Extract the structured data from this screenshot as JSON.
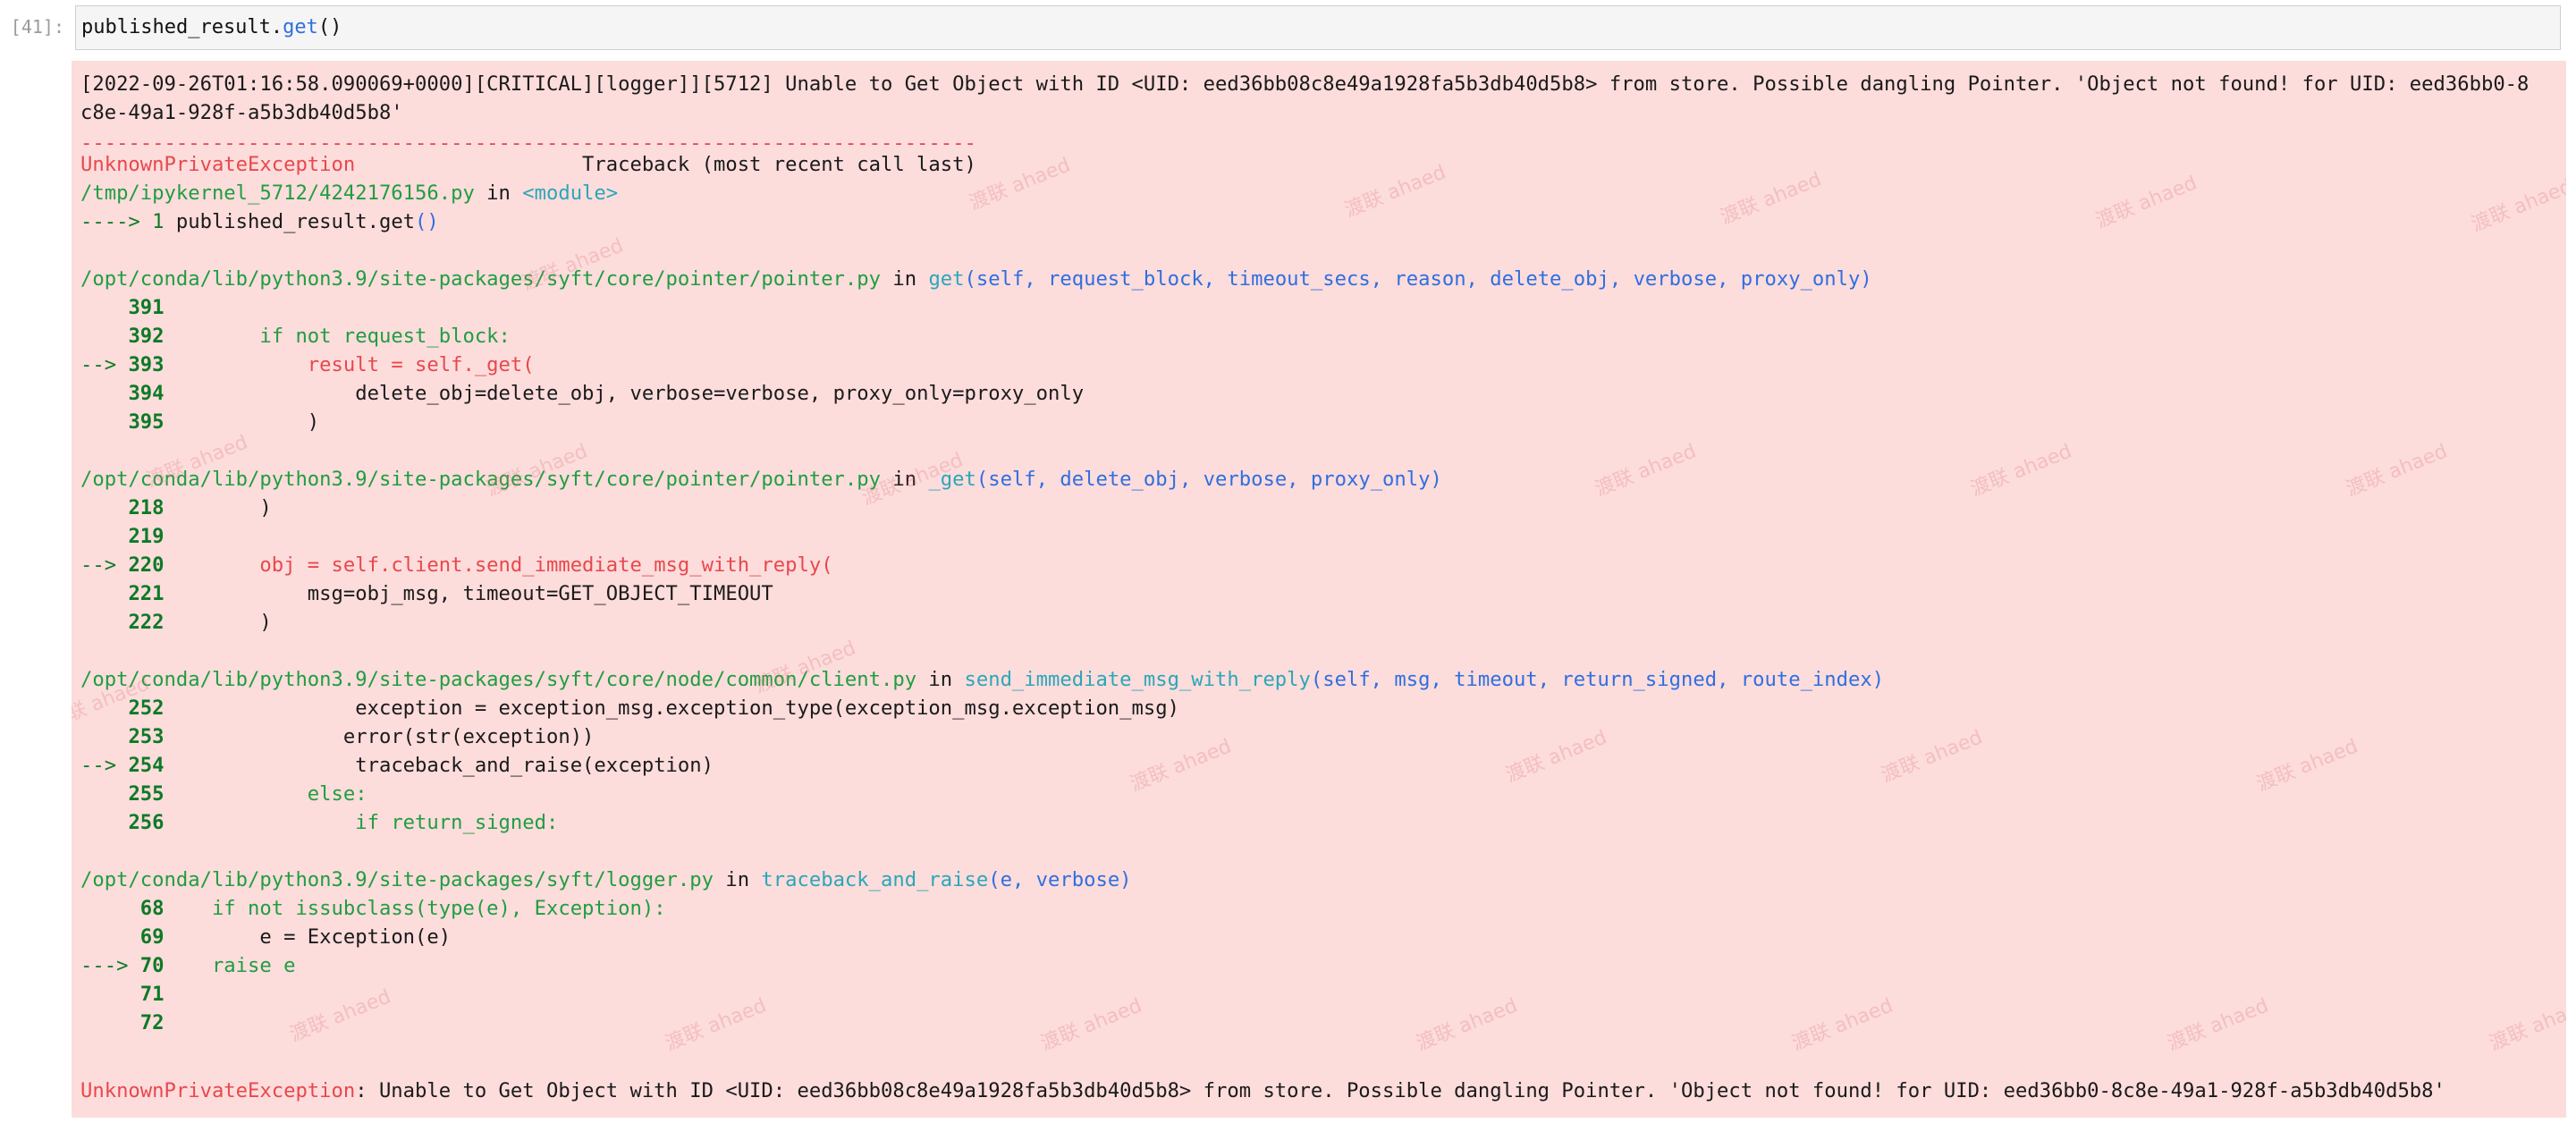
{
  "prompt": "[41]:",
  "input": {
    "obj": "published_result.",
    "method": "get",
    "rest": "()"
  },
  "log_line1": "[2022-09-26T01:16:58.090069+0000][CRITICAL][logger]][5712] Unable to Get Object with ID <UID: eed36bb08c8e49a1928fa5b3db40d5b8> from store. Possible dangling Pointer. 'Object not found! for UID: eed36bb0-8",
  "log_line2": "c8e-49a1-928f-a5b3db40d5b8'",
  "dashes": "---------------------------------------------------------------------------",
  "exc_name": "UnknownPrivateException",
  "traceback_header": "                   Traceback (most recent call last)",
  "frame0": {
    "path": "/tmp/ipykernel_5712/4242176156.py",
    "in": " in ",
    "func": "<module>"
  },
  "frame0_line": {
    "arrow": "----> 1 ",
    "code": "published_result.get",
    "paren": "()"
  },
  "frame1": {
    "path": "/opt/conda/lib/python3.9/site-packages/syft/core/pointer/pointer.py",
    "in": " in ",
    "func": "get",
    "args": "(self, request_block, timeout_secs, reason, delete_obj, verbose, proxy_only)",
    "lines": [
      {
        "prefix": "    ",
        "num": "391",
        "code": ""
      },
      {
        "prefix": "    ",
        "num": "392",
        "code": "        if not request_block:"
      },
      {
        "prefix": "--> ",
        "num": "393",
        "code": "            result = self._get("
      },
      {
        "prefix": "    ",
        "num": "394",
        "code": "                delete_obj=delete_obj, verbose=verbose, proxy_only=proxy_only"
      },
      {
        "prefix": "    ",
        "num": "395",
        "code": "            )"
      }
    ]
  },
  "frame2": {
    "path": "/opt/conda/lib/python3.9/site-packages/syft/core/pointer/pointer.py",
    "in": " in ",
    "func": "_get",
    "args": "(self, delete_obj, verbose, proxy_only)",
    "lines": [
      {
        "prefix": "    ",
        "num": "218",
        "code": "        )"
      },
      {
        "prefix": "    ",
        "num": "219",
        "code": ""
      },
      {
        "prefix": "--> ",
        "num": "220",
        "code": "        obj = self.client.send_immediate_msg_with_reply("
      },
      {
        "prefix": "    ",
        "num": "221",
        "code": "            msg=obj_msg, timeout=GET_OBJECT_TIMEOUT"
      },
      {
        "prefix": "    ",
        "num": "222",
        "code": "        )"
      }
    ]
  },
  "frame3": {
    "path": "/opt/conda/lib/python3.9/site-packages/syft/core/node/common/client.py",
    "in": " in ",
    "func": "send_immediate_msg_with_reply",
    "args": "(self, msg, timeout, return_signed, route_index)",
    "lines": [
      {
        "prefix": "    ",
        "num": "252",
        "code": "                exception = exception_msg.exception_type(exception_msg.exception_msg)"
      },
      {
        "prefix": "    ",
        "num": "253",
        "code": "               error(str(exception))"
      },
      {
        "prefix": "--> ",
        "num": "254",
        "code": "                traceback_and_raise(exception)"
      },
      {
        "prefix": "    ",
        "num": "255",
        "code": "            else:"
      },
      {
        "prefix": "    ",
        "num": "256",
        "code": "                if return_signed:"
      }
    ]
  },
  "frame4": {
    "path": "/opt/conda/lib/python3.9/site-packages/syft/logger.py",
    "in": " in ",
    "func": "traceback_and_raise",
    "args": "(e, verbose)",
    "lines": [
      {
        "prefix": "     ",
        "num": "68",
        "code": "    if not issubclass(type(e), Exception):"
      },
      {
        "prefix": "     ",
        "num": "69",
        "code": "        e = Exception(e)"
      },
      {
        "prefix": "---> ",
        "num": "70",
        "code": "    raise e"
      },
      {
        "prefix": "     ",
        "num": "71",
        "code": ""
      },
      {
        "prefix": "     ",
        "num": "72",
        "code": ""
      }
    ]
  },
  "final_msg": ": Unable to Get Object with ID <UID: eed36bb08c8e49a1928fa5b3db40d5b8> from store. Possible dangling Pointer. 'Object not found! for UID: eed36bb0-8c8e-49a1-928f-a5b3db40d5b8'",
  "watermark": "渡联 ahaed",
  "colors": {
    "exception": "#e8484c",
    "path": "#1f9e40",
    "func": "#2aa7b8",
    "args": "#2f6fdf",
    "background": "#fddcdc"
  }
}
